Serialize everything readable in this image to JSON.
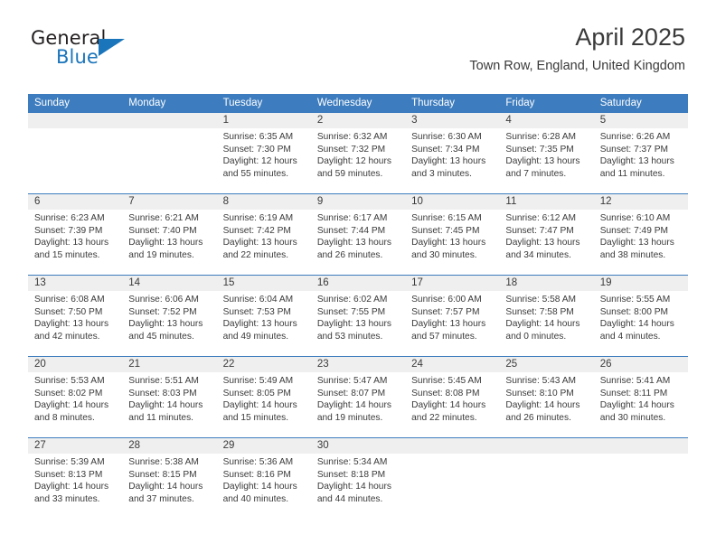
{
  "logo": {
    "word_one": "General",
    "word_two": "Blue",
    "triangle_icon": "triangle-icon",
    "brand_color": "#1b75bb",
    "text_color": "#231f20"
  },
  "header": {
    "title": "April 2025",
    "subtitle": "Town Row, England, United Kingdom"
  },
  "calendar": {
    "header_bg": "#3d7cbe",
    "date_band_bg": "#efefef",
    "weekdays": [
      "Sunday",
      "Monday",
      "Tuesday",
      "Wednesday",
      "Thursday",
      "Friday",
      "Saturday"
    ],
    "weeks": [
      [
        {
          "day": "",
          "sunrise": "",
          "sunset": "",
          "daylight": ""
        },
        {
          "day": "",
          "sunrise": "",
          "sunset": "",
          "daylight": ""
        },
        {
          "day": "1",
          "sunrise": "Sunrise: 6:35 AM",
          "sunset": "Sunset: 7:30 PM",
          "daylight": "Daylight: 12 hours and 55 minutes."
        },
        {
          "day": "2",
          "sunrise": "Sunrise: 6:32 AM",
          "sunset": "Sunset: 7:32 PM",
          "daylight": "Daylight: 12 hours and 59 minutes."
        },
        {
          "day": "3",
          "sunrise": "Sunrise: 6:30 AM",
          "sunset": "Sunset: 7:34 PM",
          "daylight": "Daylight: 13 hours and 3 minutes."
        },
        {
          "day": "4",
          "sunrise": "Sunrise: 6:28 AM",
          "sunset": "Sunset: 7:35 PM",
          "daylight": "Daylight: 13 hours and 7 minutes."
        },
        {
          "day": "5",
          "sunrise": "Sunrise: 6:26 AM",
          "sunset": "Sunset: 7:37 PM",
          "daylight": "Daylight: 13 hours and 11 minutes."
        }
      ],
      [
        {
          "day": "6",
          "sunrise": "Sunrise: 6:23 AM",
          "sunset": "Sunset: 7:39 PM",
          "daylight": "Daylight: 13 hours and 15 minutes."
        },
        {
          "day": "7",
          "sunrise": "Sunrise: 6:21 AM",
          "sunset": "Sunset: 7:40 PM",
          "daylight": "Daylight: 13 hours and 19 minutes."
        },
        {
          "day": "8",
          "sunrise": "Sunrise: 6:19 AM",
          "sunset": "Sunset: 7:42 PM",
          "daylight": "Daylight: 13 hours and 22 minutes."
        },
        {
          "day": "9",
          "sunrise": "Sunrise: 6:17 AM",
          "sunset": "Sunset: 7:44 PM",
          "daylight": "Daylight: 13 hours and 26 minutes."
        },
        {
          "day": "10",
          "sunrise": "Sunrise: 6:15 AM",
          "sunset": "Sunset: 7:45 PM",
          "daylight": "Daylight: 13 hours and 30 minutes."
        },
        {
          "day": "11",
          "sunrise": "Sunrise: 6:12 AM",
          "sunset": "Sunset: 7:47 PM",
          "daylight": "Daylight: 13 hours and 34 minutes."
        },
        {
          "day": "12",
          "sunrise": "Sunrise: 6:10 AM",
          "sunset": "Sunset: 7:49 PM",
          "daylight": "Daylight: 13 hours and 38 minutes."
        }
      ],
      [
        {
          "day": "13",
          "sunrise": "Sunrise: 6:08 AM",
          "sunset": "Sunset: 7:50 PM",
          "daylight": "Daylight: 13 hours and 42 minutes."
        },
        {
          "day": "14",
          "sunrise": "Sunrise: 6:06 AM",
          "sunset": "Sunset: 7:52 PM",
          "daylight": "Daylight: 13 hours and 45 minutes."
        },
        {
          "day": "15",
          "sunrise": "Sunrise: 6:04 AM",
          "sunset": "Sunset: 7:53 PM",
          "daylight": "Daylight: 13 hours and 49 minutes."
        },
        {
          "day": "16",
          "sunrise": "Sunrise: 6:02 AM",
          "sunset": "Sunset: 7:55 PM",
          "daylight": "Daylight: 13 hours and 53 minutes."
        },
        {
          "day": "17",
          "sunrise": "Sunrise: 6:00 AM",
          "sunset": "Sunset: 7:57 PM",
          "daylight": "Daylight: 13 hours and 57 minutes."
        },
        {
          "day": "18",
          "sunrise": "Sunrise: 5:58 AM",
          "sunset": "Sunset: 7:58 PM",
          "daylight": "Daylight: 14 hours and 0 minutes."
        },
        {
          "day": "19",
          "sunrise": "Sunrise: 5:55 AM",
          "sunset": "Sunset: 8:00 PM",
          "daylight": "Daylight: 14 hours and 4 minutes."
        }
      ],
      [
        {
          "day": "20",
          "sunrise": "Sunrise: 5:53 AM",
          "sunset": "Sunset: 8:02 PM",
          "daylight": "Daylight: 14 hours and 8 minutes."
        },
        {
          "day": "21",
          "sunrise": "Sunrise: 5:51 AM",
          "sunset": "Sunset: 8:03 PM",
          "daylight": "Daylight: 14 hours and 11 minutes."
        },
        {
          "day": "22",
          "sunrise": "Sunrise: 5:49 AM",
          "sunset": "Sunset: 8:05 PM",
          "daylight": "Daylight: 14 hours and 15 minutes."
        },
        {
          "day": "23",
          "sunrise": "Sunrise: 5:47 AM",
          "sunset": "Sunset: 8:07 PM",
          "daylight": "Daylight: 14 hours and 19 minutes."
        },
        {
          "day": "24",
          "sunrise": "Sunrise: 5:45 AM",
          "sunset": "Sunset: 8:08 PM",
          "daylight": "Daylight: 14 hours and 22 minutes."
        },
        {
          "day": "25",
          "sunrise": "Sunrise: 5:43 AM",
          "sunset": "Sunset: 8:10 PM",
          "daylight": "Daylight: 14 hours and 26 minutes."
        },
        {
          "day": "26",
          "sunrise": "Sunrise: 5:41 AM",
          "sunset": "Sunset: 8:11 PM",
          "daylight": "Daylight: 14 hours and 30 minutes."
        }
      ],
      [
        {
          "day": "27",
          "sunrise": "Sunrise: 5:39 AM",
          "sunset": "Sunset: 8:13 PM",
          "daylight": "Daylight: 14 hours and 33 minutes."
        },
        {
          "day": "28",
          "sunrise": "Sunrise: 5:38 AM",
          "sunset": "Sunset: 8:15 PM",
          "daylight": "Daylight: 14 hours and 37 minutes."
        },
        {
          "day": "29",
          "sunrise": "Sunrise: 5:36 AM",
          "sunset": "Sunset: 8:16 PM",
          "daylight": "Daylight: 14 hours and 40 minutes."
        },
        {
          "day": "30",
          "sunrise": "Sunrise: 5:34 AM",
          "sunset": "Sunset: 8:18 PM",
          "daylight": "Daylight: 14 hours and 44 minutes."
        },
        {
          "day": "",
          "sunrise": "",
          "sunset": "",
          "daylight": ""
        },
        {
          "day": "",
          "sunrise": "",
          "sunset": "",
          "daylight": ""
        },
        {
          "day": "",
          "sunrise": "",
          "sunset": "",
          "daylight": ""
        }
      ]
    ]
  }
}
